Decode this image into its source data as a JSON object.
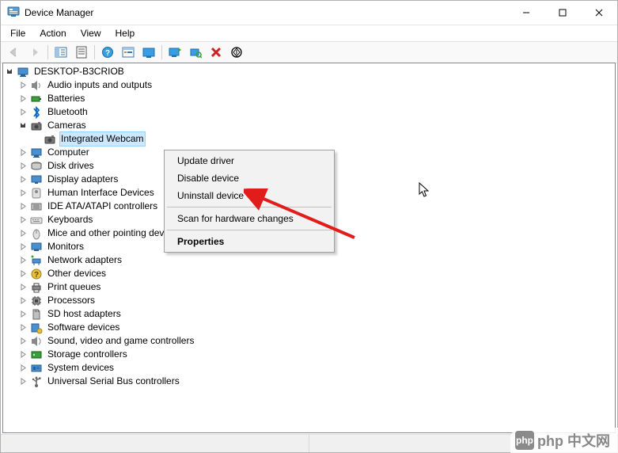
{
  "window": {
    "title": "Device Manager"
  },
  "menu": {
    "items": [
      "File",
      "Action",
      "View",
      "Help"
    ]
  },
  "toolbar": {
    "back": "Back",
    "forward": "Forward",
    "show_hide_tree": "Show/Hide Console Tree",
    "properties": "Properties",
    "help": "Help",
    "action_center": "Show Action Center",
    "dashboard": "Show Dashboard",
    "scan": "Scan for hardware changes",
    "uninstall": "Uninstall device",
    "update": "Update device driver"
  },
  "tree": {
    "root": {
      "label": "DESKTOP-B3CRIOB",
      "expanded": true
    },
    "categories": [
      {
        "label": "Audio inputs and outputs",
        "icon": "speaker"
      },
      {
        "label": "Batteries",
        "icon": "battery"
      },
      {
        "label": "Bluetooth",
        "icon": "bluetooth"
      },
      {
        "label": "Cameras",
        "icon": "camera",
        "expanded": true,
        "children": [
          {
            "label": "Integrated Webcam",
            "icon": "camera",
            "selected": true
          }
        ]
      },
      {
        "label": "Computer",
        "icon": "computer"
      },
      {
        "label": "Disk drives",
        "icon": "disk"
      },
      {
        "label": "Display adapters",
        "icon": "display"
      },
      {
        "label": "Human Interface Devices",
        "icon": "hid"
      },
      {
        "label": "IDE ATA/ATAPI controllers",
        "icon": "ide"
      },
      {
        "label": "Keyboards",
        "icon": "keyboard"
      },
      {
        "label": "Mice and other pointing devices",
        "icon": "mouse"
      },
      {
        "label": "Monitors",
        "icon": "monitor"
      },
      {
        "label": "Network adapters",
        "icon": "network"
      },
      {
        "label": "Other devices",
        "icon": "other"
      },
      {
        "label": "Print queues",
        "icon": "printer"
      },
      {
        "label": "Processors",
        "icon": "cpu"
      },
      {
        "label": "SD host adapters",
        "icon": "sd"
      },
      {
        "label": "Software devices",
        "icon": "software"
      },
      {
        "label": "Sound, video and game controllers",
        "icon": "sound"
      },
      {
        "label": "Storage controllers",
        "icon": "storage"
      },
      {
        "label": "System devices",
        "icon": "system"
      },
      {
        "label": "Universal Serial Bus controllers",
        "icon": "usb"
      }
    ]
  },
  "context_menu": {
    "items": [
      {
        "label": "Update driver",
        "type": "item"
      },
      {
        "label": "Disable device",
        "type": "item"
      },
      {
        "label": "Uninstall device",
        "type": "item"
      },
      {
        "type": "sep"
      },
      {
        "label": "Scan for hardware changes",
        "type": "item"
      },
      {
        "type": "sep"
      },
      {
        "label": "Properties",
        "type": "item",
        "bold": true
      }
    ]
  },
  "watermark": {
    "text": "php 中文网",
    "logo_text": "php"
  }
}
